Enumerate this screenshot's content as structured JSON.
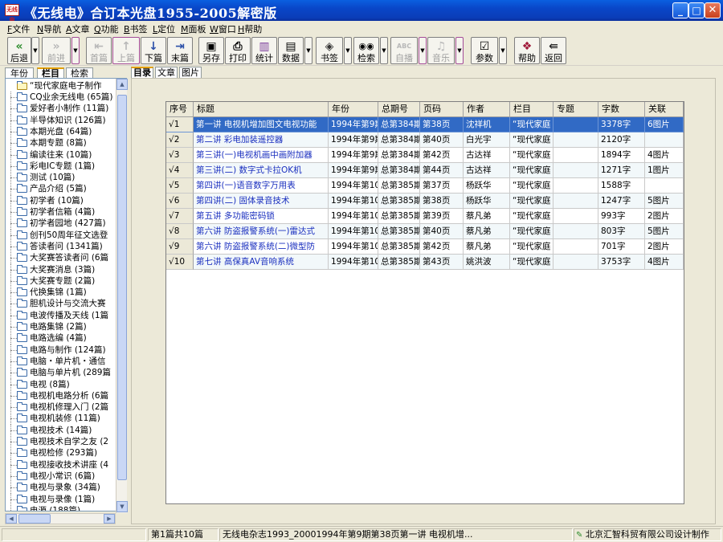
{
  "window": {
    "title": "《无线电》合订本光盘1955-2005解密版",
    "icon_text": "无线电",
    "minimize": "_",
    "maximize": "□",
    "close": "✕"
  },
  "menu": [
    {
      "key": "F",
      "label": "文件"
    },
    {
      "key": "N",
      "label": "导航"
    },
    {
      "key": "A",
      "label": "文章"
    },
    {
      "key": "Q",
      "label": "功能"
    },
    {
      "key": "B",
      "label": "书签"
    },
    {
      "key": "L",
      "label": "定位"
    },
    {
      "key": "M",
      "label": "面板"
    },
    {
      "key": "W",
      "label": "窗口"
    },
    {
      "key": "H",
      "label": "帮助"
    }
  ],
  "toolbar": {
    "back": {
      "label": "后退",
      "icon": "«"
    },
    "forward": {
      "label": "前进",
      "icon": "»"
    },
    "first": {
      "label": "首篇",
      "icon": "⇤"
    },
    "prev": {
      "label": "上篇",
      "icon": "↑"
    },
    "next": {
      "label": "下篇",
      "icon": "↓"
    },
    "last": {
      "label": "末篇",
      "icon": "⇥"
    },
    "saveas": {
      "label": "另存",
      "icon": "▣"
    },
    "print": {
      "label": "打印",
      "icon": "⎙"
    },
    "stats": {
      "label": "统计",
      "icon": "▥"
    },
    "data": {
      "label": "数据",
      "icon": "▤"
    },
    "bookmark": {
      "label": "书签",
      "icon": "◈"
    },
    "search": {
      "label": "检索",
      "icon": "◉◉"
    },
    "autoplay": {
      "label": "自播",
      "icon": "ABC"
    },
    "music": {
      "label": "音乐",
      "icon": "♫"
    },
    "params": {
      "label": "参数",
      "icon": "☑"
    },
    "help": {
      "label": "帮助",
      "icon": "❖"
    },
    "return": {
      "label": "返回",
      "icon": "⇚"
    },
    "drop_glyph": "▼"
  },
  "left_tabs": [
    "年份",
    "栏目",
    "检索"
  ],
  "tree": {
    "root": "“现代家庭电子制作",
    "items": [
      "CQ业余无线电 (65篇)",
      "爱好者小制作 (11篇)",
      "半导体知识 (126篇)",
      "本期光盘 (64篇)",
      "本期专题 (8篇)",
      "编读往来 (10篇)",
      "彩电IC专题 (1篇)",
      "测试 (10篇)",
      "产品介绍 (5篇)",
      "初学者 (10篇)",
      "初学者信箱 (4篇)",
      "初学者园地 (427篇)",
      "创刊50周年征文选登",
      "答读者问 (1341篇)",
      "大奖赛答读者问 (6篇",
      "大奖赛消息 (3篇)",
      "大奖赛专题 (2篇)",
      "代换集锦 (1篇)",
      "胆机设计与交流大赛",
      "电波传播及天线 (1篇",
      "电路集锦 (2篇)",
      "电路选编 (4篇)",
      "电路与制作 (124篇)",
      "电脑・单片机・通信",
      "电脑与单片机 (289篇",
      "电视 (8篇)",
      "电视机电路分析 (6篇",
      "电视机修理入门 (2篇",
      "电视机装修 (11篇)",
      "电视技术 (14篇)",
      "电视技术自学之友 (2",
      "电视检修 (293篇)",
      "电视接收技术讲座 (4",
      "电视小常识 (6篇)",
      "电视与录象 (34篇)",
      "电视与录像 (1篇)",
      "电源 (188篇)"
    ]
  },
  "right_tabs": [
    "目录",
    "文章",
    "图片"
  ],
  "grid": {
    "headers": [
      "序号",
      "标题",
      "年份",
      "总期号",
      "页码",
      "作者",
      "栏目",
      "专题",
      "字数",
      "关联"
    ],
    "rows": [
      [
        "√1",
        "第一讲 电视机增加图文电视功能",
        "1994年第9期",
        "总第384期",
        "第38页",
        "沈祥机",
        "“现代家庭",
        "",
        "3378字",
        "6图片"
      ],
      [
        "√2",
        "第二讲 彩电加装遥控器",
        "1994年第9期",
        "总第384期",
        "第40页",
        "白光宇",
        "“现代家庭",
        "",
        "2120字",
        ""
      ],
      [
        "√3",
        "第三讲(一)电视机画中画附加器",
        "1994年第9期",
        "总第384期",
        "第42页",
        "古达祥",
        "“现代家庭",
        "",
        "1894字",
        "4图片"
      ],
      [
        "√4",
        "第三讲(二) 数字式卡拉OK机",
        "1994年第9期",
        "总第384期",
        "第44页",
        "古达祥",
        "“现代家庭",
        "",
        "1271字",
        "1图片"
      ],
      [
        "√5",
        "第四讲(一)语音数字万用表",
        "1994年第10期",
        "总第385期",
        "第37页",
        "杨跃华",
        "“现代家庭",
        "",
        "1588字",
        ""
      ],
      [
        "√6",
        "第四讲(二) 固体录音技术",
        "1994年第10期",
        "总第385期",
        "第38页",
        "杨跃华",
        "“现代家庭",
        "",
        "1247字",
        "5图片"
      ],
      [
        "√7",
        "第五讲 多功能密码锁",
        "1994年第10期",
        "总第385期",
        "第39页",
        "蔡凡弟",
        "“现代家庭",
        "",
        "993字",
        "2图片"
      ],
      [
        "√8",
        "第六讲 防盗报警系统(一)雷达式",
        "1994年第10期",
        "总第385期",
        "第40页",
        "蔡凡弟",
        "“现代家庭",
        "",
        "803字",
        "5图片"
      ],
      [
        "√9",
        "第六讲 防盗报警系统(二)微型防",
        "1994年第10期",
        "总第385期",
        "第42页",
        "蔡凡弟",
        "“现代家庭",
        "",
        "701字",
        "2图片"
      ],
      [
        "√10",
        "第七讲 高保真AV音响系统",
        "1994年第10期",
        "总第385期",
        "第43页",
        "姚洪波",
        "“现代家庭",
        "",
        "3753字",
        "4图片"
      ]
    ],
    "selected_row": 0
  },
  "status": {
    "count": "第1篇共10篇",
    "path": "无线电杂志1993_20001994年第9期第38页第一讲 电视机增...",
    "company": "北京汇智科贸有限公司设计制作"
  },
  "colors": {
    "titlebar": "#0A46C8",
    "selection": "#316AC5",
    "title_link": "#1A2FBF",
    "face": "#ECE9D8"
  }
}
